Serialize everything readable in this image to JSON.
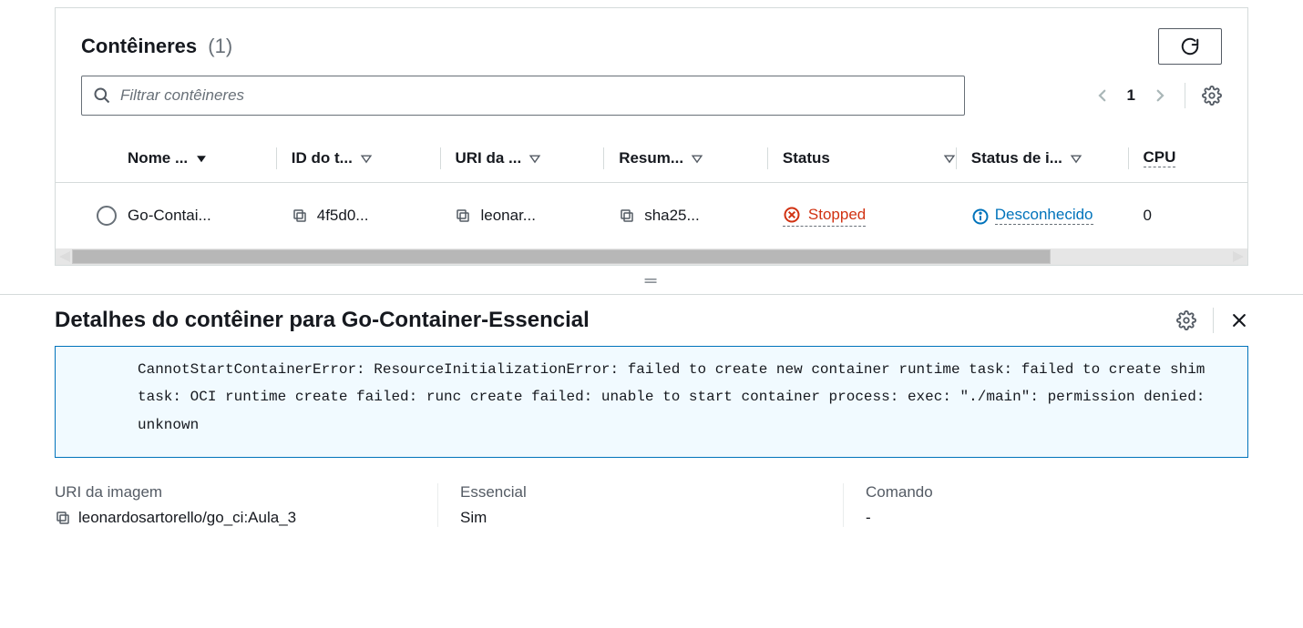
{
  "top": {
    "title": "Contêineres",
    "count": "(1)",
    "search_placeholder": "Filtrar contêineres",
    "page": "1"
  },
  "columns": {
    "name": "Nome ...",
    "id": "ID do t...",
    "uri": "URI da ...",
    "summary": "Resum...",
    "status": "Status",
    "imgstat": "Status de i...",
    "cpu": "CPU"
  },
  "rows": [
    {
      "name": "Go-Contai...",
      "id": "4f5d0...",
      "uri": "leonar...",
      "summary": "sha25...",
      "status": "Stopped",
      "imgstat": "Desconhecido",
      "cpu": "0"
    }
  ],
  "details": {
    "title": "Detalhes do contêiner para Go-Container-Essencial",
    "error": "CannotStartContainerError: ResourceInitializationError: failed to create new container runtime task: failed to create shim task: OCI runtime create failed: runc create failed: unable to start container process: exec: \"./main\": permission denied: unknown",
    "cols": {
      "uri_label": "URI da imagem",
      "uri_value": "leonardosartorello/go_ci:Aula_3",
      "ess_label": "Essencial",
      "ess_value": "Sim",
      "cmd_label": "Comando",
      "cmd_value": "-"
    }
  }
}
